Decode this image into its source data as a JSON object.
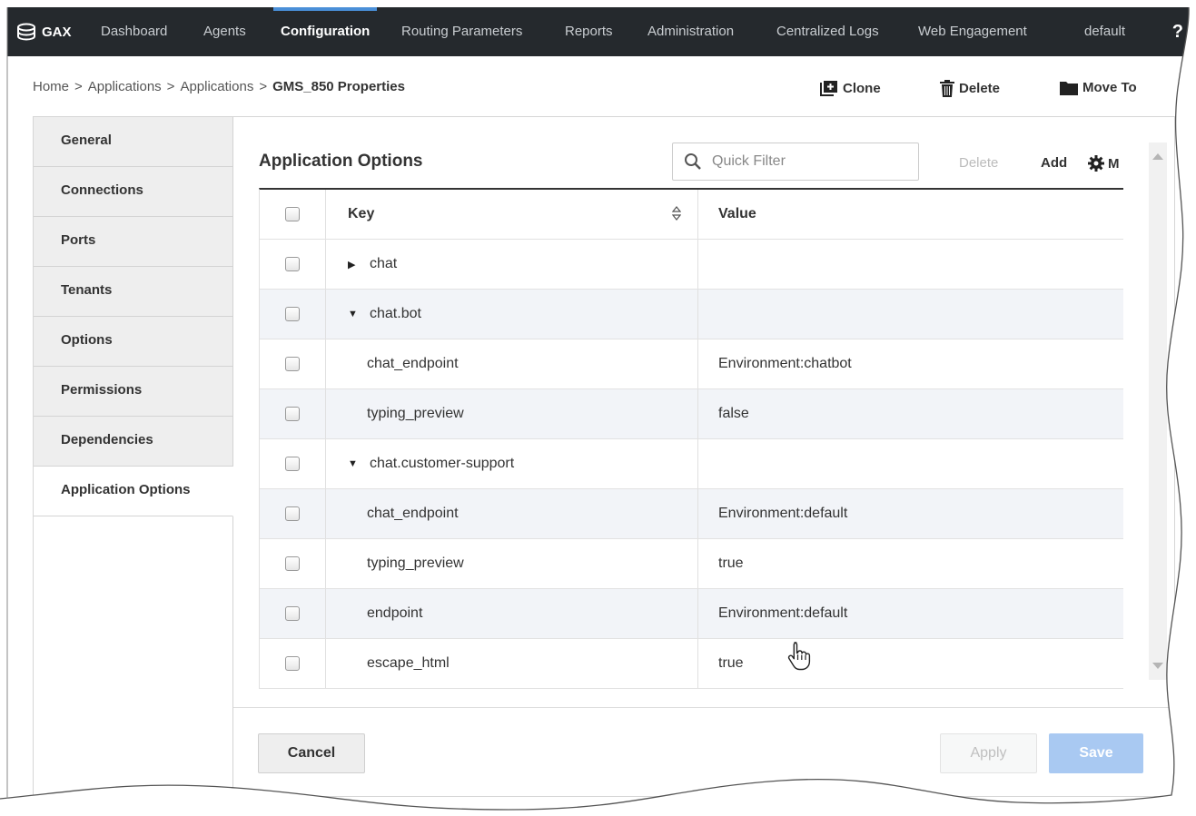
{
  "topnav": {
    "brand": "GAX",
    "items": [
      "Dashboard",
      "Agents",
      "Configuration",
      "Routing Parameters",
      "Reports",
      "Administration",
      "Centralized Logs",
      "Web Engagement"
    ],
    "active_index": 2,
    "tenant": "default",
    "help": "?"
  },
  "breadcrumb": {
    "home": "Home",
    "sep": ">",
    "applications1": "Applications",
    "applications2": "Applications",
    "current": "GMS_850 Properties"
  },
  "actions": {
    "clone": "Clone",
    "delete": "Delete",
    "move_to": "Move To"
  },
  "tabs": [
    "General",
    "Connections",
    "Ports",
    "Tenants",
    "Options",
    "Permissions",
    "Dependencies",
    "Application Options"
  ],
  "active_tab_index": 7,
  "panel": {
    "title": "Application Options",
    "filter_placeholder": "Quick Filter",
    "delete": "Delete",
    "add": "Add",
    "more": "M"
  },
  "table": {
    "columns": {
      "key": "Key",
      "value": "Value"
    },
    "rows": [
      {
        "key": "chat",
        "value": "",
        "type": "section",
        "expanded": false
      },
      {
        "key": "chat.bot",
        "value": "",
        "type": "section",
        "expanded": true
      },
      {
        "key": "chat_endpoint",
        "value": "Environment:chatbot",
        "type": "option"
      },
      {
        "key": "typing_preview",
        "value": "false",
        "type": "option"
      },
      {
        "key": "chat.customer-support",
        "value": "",
        "type": "section",
        "expanded": true
      },
      {
        "key": "chat_endpoint",
        "value": "Environment:default",
        "type": "option"
      },
      {
        "key": "typing_preview",
        "value": "true",
        "type": "option"
      },
      {
        "key": "endpoint",
        "value": "Environment:default",
        "type": "option"
      },
      {
        "key": "escape_html",
        "value": "true",
        "type": "option"
      }
    ]
  },
  "footer": {
    "cancel": "Cancel",
    "apply": "Apply",
    "save": "Save"
  },
  "colors": {
    "nav_bg": "#25292d",
    "nav_active_bar": "#4a8fd8",
    "save_bg": "#a9c9f2",
    "row_alt": "#f2f4f8"
  }
}
